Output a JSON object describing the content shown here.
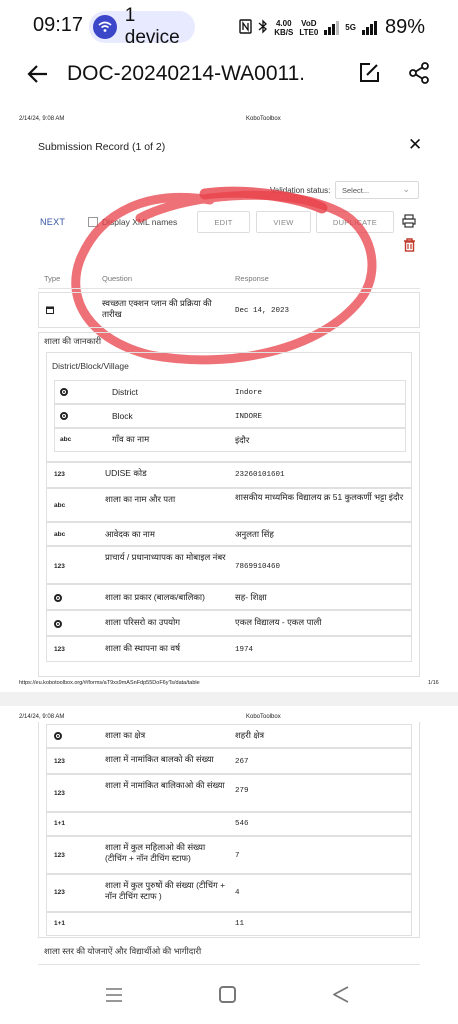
{
  "status_bar": {
    "time": "09:17",
    "device_label": "1 device",
    "net_speed_top": "4.00",
    "net_speed_unit": "KB/S",
    "volte_top": "VoD",
    "volte_bottom": "LTE0",
    "net_5g": "5G",
    "battery": "89%"
  },
  "app_bar": {
    "title": "DOC-20240214-WA0011."
  },
  "page1": {
    "header_date": "2/14/24, 9:08 AM",
    "header_brand": "KoboToolbox",
    "submission_title": "Submission Record (1 of 2)",
    "validation_label": "Validation status:",
    "validation_placeholder": "Select...",
    "next_label": "NEXT",
    "xml_label": "Display XML names",
    "edit_label": "EDIT",
    "view_label": "VIEW",
    "duplicate_label": "DUPLICATE",
    "columns": [
      "Type",
      "Question",
      "Response"
    ],
    "rows": {
      "survey_date": {
        "type": "",
        "question": "स्वच्छता एक्शन प्लान की प्रक्रिया की तारीख",
        "response": "Dec 14, 2023"
      },
      "group_school": "शाला की जानकारी",
      "group_location": "District/Block/Village",
      "district": {
        "question": "District",
        "response": "Indore"
      },
      "block": {
        "question": "Block",
        "response": "INDORE"
      },
      "village": {
        "type": "abc",
        "question": "गाँव का नाम",
        "response": "इंदौर"
      },
      "udise": {
        "type": "123",
        "question": "UDISE कोड",
        "response": "23260101601"
      },
      "school_name": {
        "type": "abc",
        "question": "शाला का नाम और पता",
        "response": "शासकीय माध्यमिक विद्यालय क्र 51 कुलकर्णी भट्टा इंदौर"
      },
      "applicant": {
        "type": "abc",
        "question": "आवेदक का नाम",
        "response": "अनुलता सिंह"
      },
      "mobile": {
        "type": "123",
        "question": "प्राचार्य / प्रधानाध्यापक का मोबाइल नंबर",
        "response": "7869910460"
      },
      "school_type": {
        "question": "शाला का प्रकार (बालक/बालिका)",
        "response": "सह- शिक्षा"
      },
      "campus_use": {
        "question": "शाला परिसरो का उपयोग",
        "response": "एकल विद्यालय - एकल पाली"
      },
      "est_year": {
        "type": "123",
        "question": "शाला की स्थापना का वर्ष",
        "response": "1974"
      }
    },
    "footer_url": "https://eu.kobotoolbox.org/#/forms/aT9xs9mASnFdp55DoF6yTs/data/table",
    "footer_page": "1/16"
  },
  "page2": {
    "header_date": "2/14/24, 9:08 AM",
    "header_brand": "KoboToolbox",
    "rows": {
      "area": {
        "question": "शाला का क्षेत्र",
        "response": "शहरी क्षेत्र"
      },
      "boys": {
        "type": "123",
        "question": "शाला में नामांकित बालको की संख्या",
        "response": "267"
      },
      "girls": {
        "type": "123",
        "question": "शाला में नामांकित बालिकाओ की संख्या",
        "response": "279"
      },
      "total_students": {
        "type": "1+1",
        "question": "",
        "response": "546"
      },
      "female_staff": {
        "type": "123",
        "question": "शाला में कुल महिलाओ की संख्या (टीचिंग + नॉन टीचिंग स्टाफ)",
        "response": "7"
      },
      "male_staff": {
        "type": "123",
        "question": "शाला में कुल पुरुषों की संख्या (टीचिंग + नॉन टीचिंग स्टाफ )",
        "response": "4"
      },
      "total_staff": {
        "type": "1+1",
        "question": "",
        "response": "11"
      }
    },
    "group_schemes": "शाला स्तर की योजनाऐं और विद्यार्थीओ की भागीदारी"
  },
  "colors": {
    "accent_blue": "#3553a5",
    "scribble_red": "#e8424a",
    "trash_red": "#c0392b",
    "pill_bg": "#e8eaff",
    "pill_dot": "#3c46c9"
  }
}
